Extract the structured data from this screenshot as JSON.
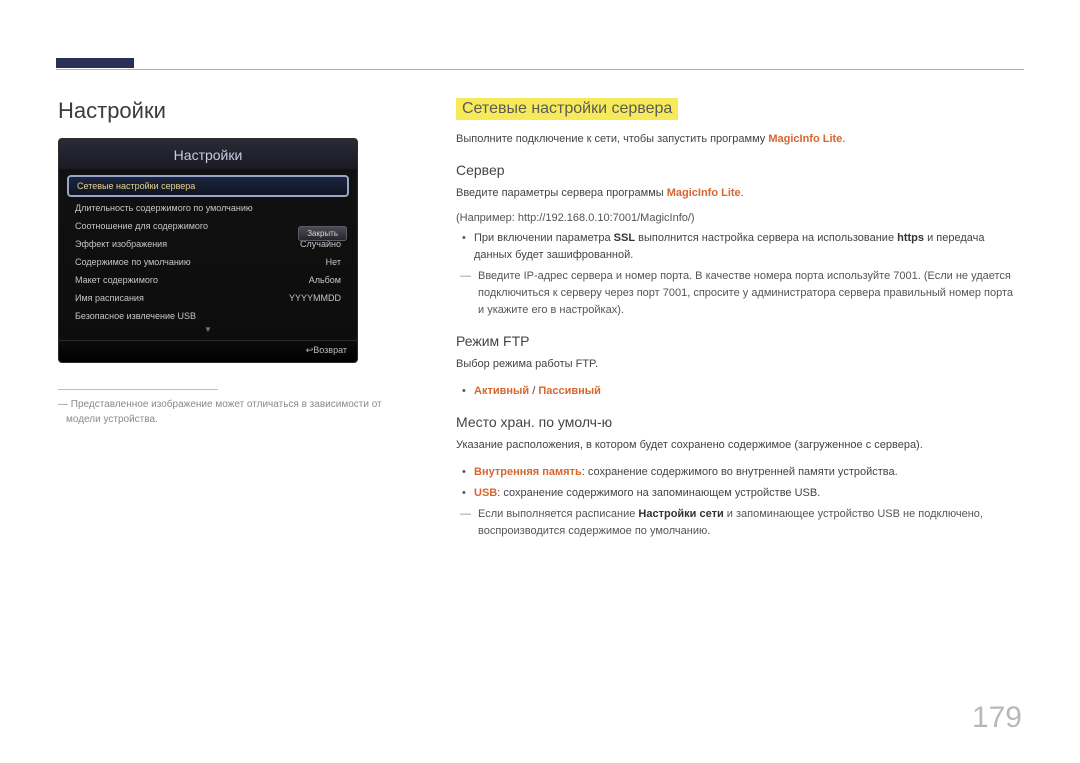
{
  "page_number": "179",
  "left": {
    "title": "Настройки",
    "screen": {
      "title": "Настройки",
      "selected": "Сетевые настройки сервера",
      "rows": [
        {
          "label": "Длительность содержимого по умолчанию",
          "value": ""
        },
        {
          "label": "Соотношение для содержимого",
          "value": ""
        },
        {
          "label": "Эффект изображения",
          "value": "Случайно"
        },
        {
          "label": "Содержимое по умолчанию",
          "value": "Нет"
        },
        {
          "label": "Макет содержимого",
          "value": "Альбом"
        },
        {
          "label": "Имя расписания",
          "value": "YYYYMMDD"
        },
        {
          "label": "Безопасное извлечение USB",
          "value": ""
        }
      ],
      "close_label": "Закрыть",
      "footer": "Возврат"
    },
    "note_prefix": "―",
    "note": "Представленное изображение может отличаться в зависимости от модели устройства."
  },
  "right": {
    "section_title": "Сетевые настройки сервера",
    "intro_a": "Выполните подключение к сети, чтобы запустить программу ",
    "intro_brand": "MagicInfo Lite",
    "intro_dot": ".",
    "server": {
      "heading": "Сервер",
      "line1_a": "Введите параметры сервера программы ",
      "line1_brand": "MagicInfo Lite",
      "line1_dot": ".",
      "example": "(Например: http://192.168.0.10:7001/MagicInfo/)",
      "bullet1_a": "При включении параметра ",
      "bullet1_ssl": "SSL",
      "bullet1_b": " выполнится настройка сервера на использование ",
      "bullet1_https": "https",
      "bullet1_c": " и передача данных будет зашифрованной.",
      "dash": "Введите IP-адрес сервера и номер порта. В качестве номера порта используйте 7001. (Если не удается подключиться к серверу через порт 7001, спросите у администратора сервера правильный номер порта и укажите его в настройках)."
    },
    "ftp": {
      "heading": "Режим FTP",
      "line1": "Выбор режима работы FTP.",
      "opt1": "Активный",
      "sep": " / ",
      "opt2": "Пассивный"
    },
    "storage": {
      "heading": "Место хран. по умолч-ю",
      "line1": "Указание расположения, в котором будет сохранено содержимое (загруженное с сервера).",
      "b1_label": "Внутренняя память",
      "b1_text": ": сохранение содержимого во внутренней памяти устройства.",
      "b2_label": "USB",
      "b2_text": ": сохранение содержимого на запоминающем устройстве USB.",
      "dash_a": "Если выполняется расписание ",
      "dash_bold": "Настройки сети",
      "dash_b": " и запоминающее устройство USB не подключено, воспроизводится содержимое по умолчанию."
    }
  }
}
